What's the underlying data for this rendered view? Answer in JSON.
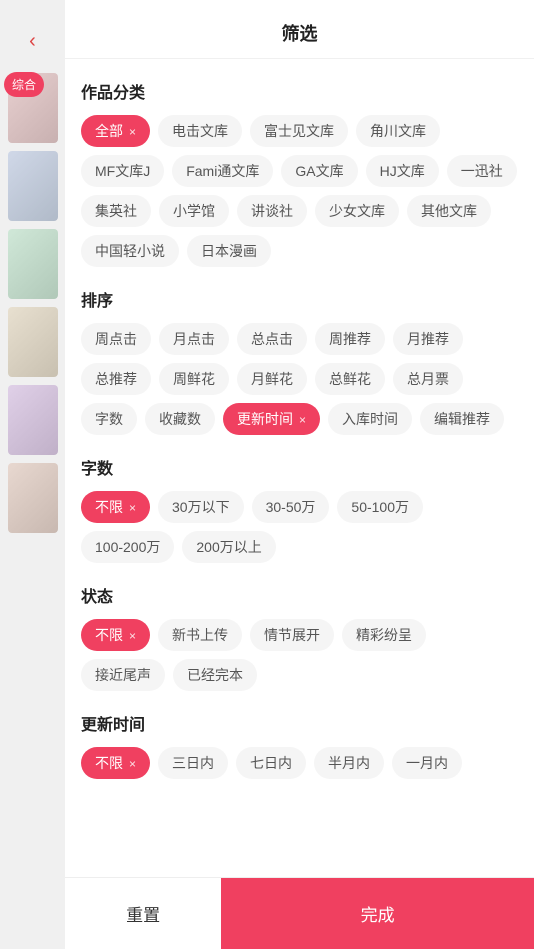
{
  "header": {
    "title": "筛选",
    "back_label": "‹"
  },
  "sections": [
    {
      "id": "category",
      "title": "作品分类",
      "tags": [
        {
          "label": "全部",
          "active": true,
          "closeable": true
        },
        {
          "label": "电击文库",
          "active": false
        },
        {
          "label": "富士见文库",
          "active": false
        },
        {
          "label": "角川文库",
          "active": false
        },
        {
          "label": "MF文库J",
          "active": false
        },
        {
          "label": "Fami通文库",
          "active": false
        },
        {
          "label": "GA文库",
          "active": false
        },
        {
          "label": "HJ文库",
          "active": false
        },
        {
          "label": "一迅社",
          "active": false
        },
        {
          "label": "集英社",
          "active": false
        },
        {
          "label": "小学馆",
          "active": false
        },
        {
          "label": "讲谈社",
          "active": false
        },
        {
          "label": "少女文库",
          "active": false
        },
        {
          "label": "其他文库",
          "active": false
        },
        {
          "label": "中国轻小说",
          "active": false
        },
        {
          "label": "日本漫画",
          "active": false
        }
      ]
    },
    {
      "id": "sort",
      "title": "排序",
      "tags": [
        {
          "label": "周点击",
          "active": false
        },
        {
          "label": "月点击",
          "active": false
        },
        {
          "label": "总点击",
          "active": false
        },
        {
          "label": "周推荐",
          "active": false
        },
        {
          "label": "月推荐",
          "active": false
        },
        {
          "label": "总推荐",
          "active": false
        },
        {
          "label": "周鲜花",
          "active": false
        },
        {
          "label": "月鲜花",
          "active": false
        },
        {
          "label": "总鲜花",
          "active": false
        },
        {
          "label": "总月票",
          "active": false
        },
        {
          "label": "字数",
          "active": false
        },
        {
          "label": "收藏数",
          "active": false
        },
        {
          "label": "更新时间",
          "active": true,
          "closeable": true
        },
        {
          "label": "入库时间",
          "active": false
        },
        {
          "label": "编辑推荐",
          "active": false
        }
      ]
    },
    {
      "id": "wordcount",
      "title": "字数",
      "tags": [
        {
          "label": "不限",
          "active": true,
          "closeable": true
        },
        {
          "label": "30万以下",
          "active": false
        },
        {
          "label": "30-50万",
          "active": false
        },
        {
          "label": "50-100万",
          "active": false
        },
        {
          "label": "100-200万",
          "active": false
        },
        {
          "label": "200万以上",
          "active": false
        }
      ]
    },
    {
      "id": "status",
      "title": "状态",
      "tags": [
        {
          "label": "不限",
          "active": true,
          "closeable": true
        },
        {
          "label": "新书上传",
          "active": false
        },
        {
          "label": "情节展开",
          "active": false
        },
        {
          "label": "精彩纷呈",
          "active": false
        },
        {
          "label": "接近尾声",
          "active": false
        },
        {
          "label": "已经完本",
          "active": false
        }
      ]
    },
    {
      "id": "update_time",
      "title": "更新时间",
      "tags": [
        {
          "label": "不限",
          "active": true,
          "closeable": true
        },
        {
          "label": "三日内",
          "active": false
        },
        {
          "label": "七日内",
          "active": false
        },
        {
          "label": "半月内",
          "active": false
        },
        {
          "label": "一月内",
          "active": false
        }
      ]
    }
  ],
  "bottom": {
    "reset_label": "重置",
    "confirm_label": "完成"
  },
  "side": {
    "tab_label": "综合",
    "back_icon": "‹"
  }
}
